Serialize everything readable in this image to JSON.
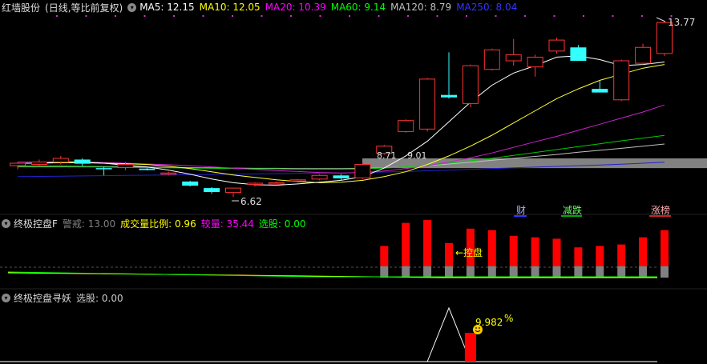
{
  "main_header": {
    "stock_name": "红墙股份",
    "period": "(日线,等比前复权)",
    "ma": [
      {
        "label": "MA5: 12.15",
        "color": "#ffffff"
      },
      {
        "label": "MA10: 12.05",
        "color": "#ffff00"
      },
      {
        "label": "MA20: 10.39",
        "color": "#ff00ff"
      },
      {
        "label": "MA60: 9.14",
        "color": "#00ff00"
      },
      {
        "label": "MA120: 8.79",
        "color": "#c0c0c0"
      },
      {
        "label": "MA250: 8.04",
        "color": "#3333ff"
      }
    ]
  },
  "ind1_header": {
    "name": "终极控盘F",
    "items": [
      {
        "label": "警戒: 13.00",
        "color": "#808080"
      },
      {
        "label": "成交量比例: 0.96",
        "color": "#ffff00"
      },
      {
        "label": "较量: 35.44",
        "color": "#ff00ff"
      },
      {
        "label": "选股: 0.00",
        "color": "#00ff00"
      }
    ]
  },
  "ind2_header": {
    "name": "终极控盘寻妖",
    "items": [
      {
        "label": "选股: 0.00",
        "color": "#cccccc"
      }
    ]
  },
  "markers": {
    "cai": "财",
    "jiandie": "减跌",
    "zhangbang": "涨榜",
    "kongpan": "控盘",
    "high_label": "13.77",
    "low_label": "6.62",
    "price_a": "8.71",
    "price_b": "9.01",
    "pct_value": "9.982",
    "pct_sign": "%"
  },
  "chart_data": {
    "type": "candlestick",
    "price_range": [
      6.0,
      14.3
    ],
    "candles": [
      {
        "o": 7.9,
        "h": 8.05,
        "l": 7.75,
        "c": 8.0
      },
      {
        "o": 7.95,
        "h": 8.15,
        "l": 7.85,
        "c": 8.05
      },
      {
        "o": 8.05,
        "h": 8.3,
        "l": 7.95,
        "c": 8.2
      },
      {
        "o": 8.15,
        "h": 8.2,
        "l": 7.9,
        "c": 7.98
      },
      {
        "o": 7.8,
        "h": 7.85,
        "l": 7.5,
        "c": 7.78
      },
      {
        "o": 7.82,
        "h": 8.05,
        "l": 7.72,
        "c": 7.95
      },
      {
        "o": 7.78,
        "h": 7.8,
        "l": 7.7,
        "c": 7.72
      },
      {
        "o": 7.55,
        "h": 7.65,
        "l": 7.5,
        "c": 7.6
      },
      {
        "o": 7.25,
        "h": 7.28,
        "l": 7.05,
        "c": 7.08
      },
      {
        "o": 6.98,
        "h": 7.02,
        "l": 6.75,
        "c": 6.82
      },
      {
        "o": 6.8,
        "h": 7.0,
        "l": 6.62,
        "c": 6.98
      },
      {
        "o": 7.15,
        "h": 7.22,
        "l": 7.05,
        "c": 7.18
      },
      {
        "o": 7.15,
        "h": 7.25,
        "l": 7.1,
        "c": 7.2
      },
      {
        "o": 7.3,
        "h": 7.35,
        "l": 7.2,
        "c": 7.32
      },
      {
        "o": 7.35,
        "h": 7.55,
        "l": 7.3,
        "c": 7.5
      },
      {
        "o": 7.5,
        "h": 7.55,
        "l": 7.3,
        "c": 7.38
      },
      {
        "o": 7.4,
        "h": 8.0,
        "l": 7.35,
        "c": 7.95
      },
      {
        "o": 8.4,
        "h": 8.75,
        "l": 8.35,
        "c": 8.7
      },
      {
        "o": 9.3,
        "h": 9.8,
        "l": 9.25,
        "c": 9.75
      },
      {
        "o": 9.4,
        "h": 11.5,
        "l": 9.3,
        "c": 11.45
      },
      {
        "o": 10.8,
        "h": 12.55,
        "l": 10.65,
        "c": 10.7
      },
      {
        "o": 10.45,
        "h": 12.05,
        "l": 10.3,
        "c": 12.0
      },
      {
        "o": 11.85,
        "h": 12.7,
        "l": 11.8,
        "c": 12.65
      },
      {
        "o": 12.2,
        "h": 13.1,
        "l": 12.0,
        "c": 12.45
      },
      {
        "o": 11.95,
        "h": 12.45,
        "l": 11.55,
        "c": 12.35
      },
      {
        "o": 12.6,
        "h": 13.15,
        "l": 12.5,
        "c": 13.05
      },
      {
        "o": 12.75,
        "h": 12.85,
        "l": 12.2,
        "c": 12.2
      },
      {
        "o": 11.05,
        "h": 11.4,
        "l": 10.95,
        "c": 10.9
      },
      {
        "o": 10.6,
        "h": 12.25,
        "l": 10.55,
        "c": 12.2
      },
      {
        "o": 12.1,
        "h": 12.9,
        "l": 12.05,
        "c": 12.75
      },
      {
        "o": 12.5,
        "h": 13.8,
        "l": 12.4,
        "c": 13.77
      }
    ],
    "ma5": [
      8.0,
      8.0,
      8.05,
      8.05,
      8.0,
      7.92,
      7.85,
      7.72,
      7.55,
      7.35,
      7.2,
      7.12,
      7.1,
      7.15,
      7.22,
      7.3,
      7.45,
      7.8,
      8.3,
      8.9,
      9.7,
      10.5,
      11.2,
      11.7,
      12.0,
      12.35,
      12.4,
      12.25,
      12.0,
      12.05,
      12.15
    ],
    "ma10": [
      8.0,
      8.0,
      8.02,
      8.02,
      8.0,
      7.98,
      7.95,
      7.88,
      7.78,
      7.65,
      7.52,
      7.42,
      7.32,
      7.25,
      7.2,
      7.22,
      7.3,
      7.45,
      7.65,
      7.95,
      8.3,
      8.7,
      9.15,
      9.65,
      10.15,
      10.65,
      11.05,
      11.4,
      11.65,
      11.9,
      12.05
    ],
    "ma20": [
      8.05,
      8.05,
      8.05,
      8.05,
      8.03,
      8.0,
      7.97,
      7.94,
      7.9,
      7.85,
      7.8,
      7.75,
      7.7,
      7.66,
      7.62,
      7.6,
      7.62,
      7.68,
      7.78,
      7.9,
      8.05,
      8.22,
      8.42,
      8.65,
      8.88,
      9.1,
      9.35,
      9.6,
      9.85,
      10.1,
      10.39
    ],
    "ma60": [
      7.85,
      7.85,
      7.85,
      7.85,
      7.84,
      7.83,
      7.82,
      7.81,
      7.8,
      7.79,
      7.78,
      7.77,
      7.77,
      7.76,
      7.76,
      7.76,
      7.77,
      7.8,
      7.85,
      7.92,
      8.0,
      8.1,
      8.2,
      8.32,
      8.44,
      8.56,
      8.68,
      8.8,
      8.92,
      9.03,
      9.14
    ],
    "ma120": [
      7.88,
      7.88,
      7.88,
      7.87,
      7.86,
      7.85,
      7.84,
      7.83,
      7.82,
      7.81,
      7.8,
      7.79,
      7.79,
      7.78,
      7.78,
      7.78,
      7.79,
      7.81,
      7.85,
      7.9,
      7.97,
      8.04,
      8.12,
      8.2,
      8.28,
      8.36,
      8.45,
      8.53,
      8.61,
      8.7,
      8.79
    ],
    "ma250": [
      7.45,
      7.46,
      7.47,
      7.48,
      7.49,
      7.5,
      7.51,
      7.52,
      7.53,
      7.54,
      7.55,
      7.56,
      7.57,
      7.58,
      7.59,
      7.6,
      7.62,
      7.64,
      7.66,
      7.69,
      7.72,
      7.75,
      7.78,
      7.81,
      7.84,
      7.87,
      7.9,
      7.93,
      7.96,
      8.0,
      8.04
    ],
    "volume_bars": [
      0,
      0,
      0,
      0,
      0,
      0,
      0,
      0,
      0,
      0,
      0,
      0,
      0,
      0,
      0,
      0,
      0,
      1.4,
      3.0,
      3.2,
      1.6,
      2.6,
      2.5,
      2.1,
      2.0,
      1.9,
      1.3,
      1.4,
      1.5,
      2.0,
      2.5
    ],
    "volume_base": [
      0,
      0,
      0,
      0,
      0,
      0,
      0,
      0,
      0,
      0,
      0,
      0,
      0,
      0,
      0,
      0,
      0,
      0.8,
      0.8,
      0.8,
      0.8,
      0.8,
      0.8,
      0.8,
      0.8,
      0.8,
      0.8,
      0.8,
      0.8,
      0.8,
      0.8
    ],
    "signal_triangle": {
      "start": 19,
      "peak": 20,
      "end": 21
    },
    "signal_bar": {
      "index": 21,
      "value": 9.982
    }
  }
}
